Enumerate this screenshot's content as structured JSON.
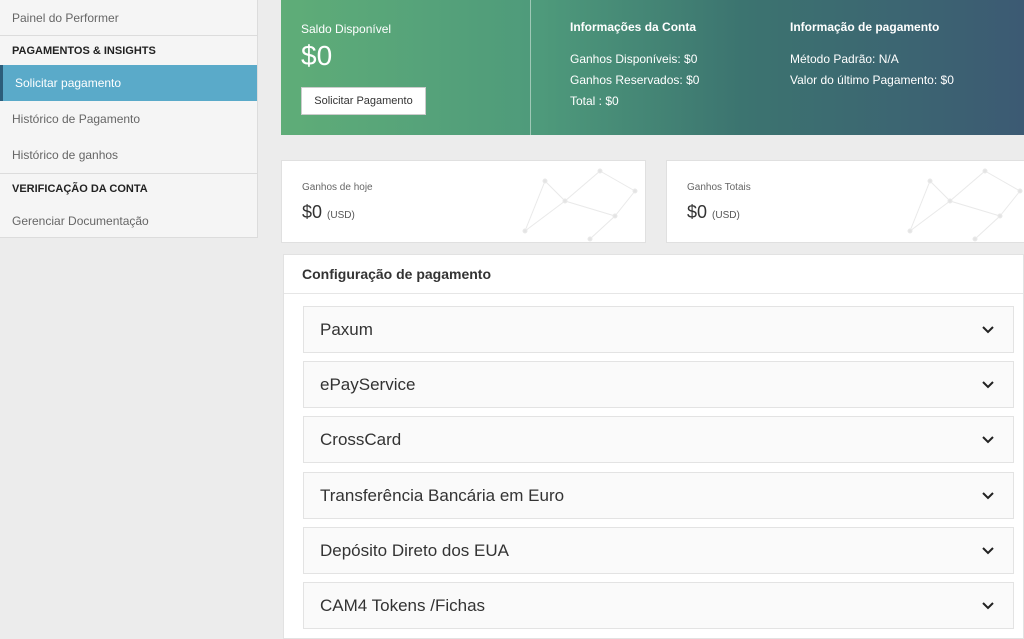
{
  "sidebar": {
    "dashboard": "Painel do Performer",
    "section_payments": "PAGAMENTOS & INSIGHTS",
    "request_payment": "Solicitar pagamento",
    "payment_history": "Histórico de Pagamento",
    "earnings_history": "Histórico de ganhos",
    "section_verification": "VERIFICAÇÃO DA CONTA",
    "manage_docs": "Gerenciar Documentação"
  },
  "banner": {
    "balance_label": "Saldo Disponível",
    "balance_value": "$0",
    "request_button": "Solicitar Pagamento",
    "account_info": {
      "title": "Informações da Conta",
      "available": "Ganhos Disponíveis: $0",
      "reserved": "Ganhos Reservados: $0",
      "total": "Total : $0"
    },
    "payment_info": {
      "title": "Informação de pagamento",
      "default_method": "Método Padrão: N/A",
      "last_payment": "Valor do último Pagamento: $0"
    }
  },
  "stats": {
    "today": {
      "label": "Ganhos de hoje",
      "value": "$0",
      "currency": "(USD)"
    },
    "total": {
      "label": "Ganhos Totais",
      "value": "$0",
      "currency": "(USD)"
    }
  },
  "config": {
    "title": "Configuração de pagamento",
    "methods": [
      "Paxum",
      "ePayService",
      "CrossCard",
      "Transferência Bancária em Euro",
      "Depósito Direto dos EUA",
      "CAM4 Tokens /Fichas"
    ]
  },
  "colors": {
    "active_sidebar": "#5aaac9",
    "banner_start": "#5fad78",
    "banner_end": "#3c5a73"
  }
}
